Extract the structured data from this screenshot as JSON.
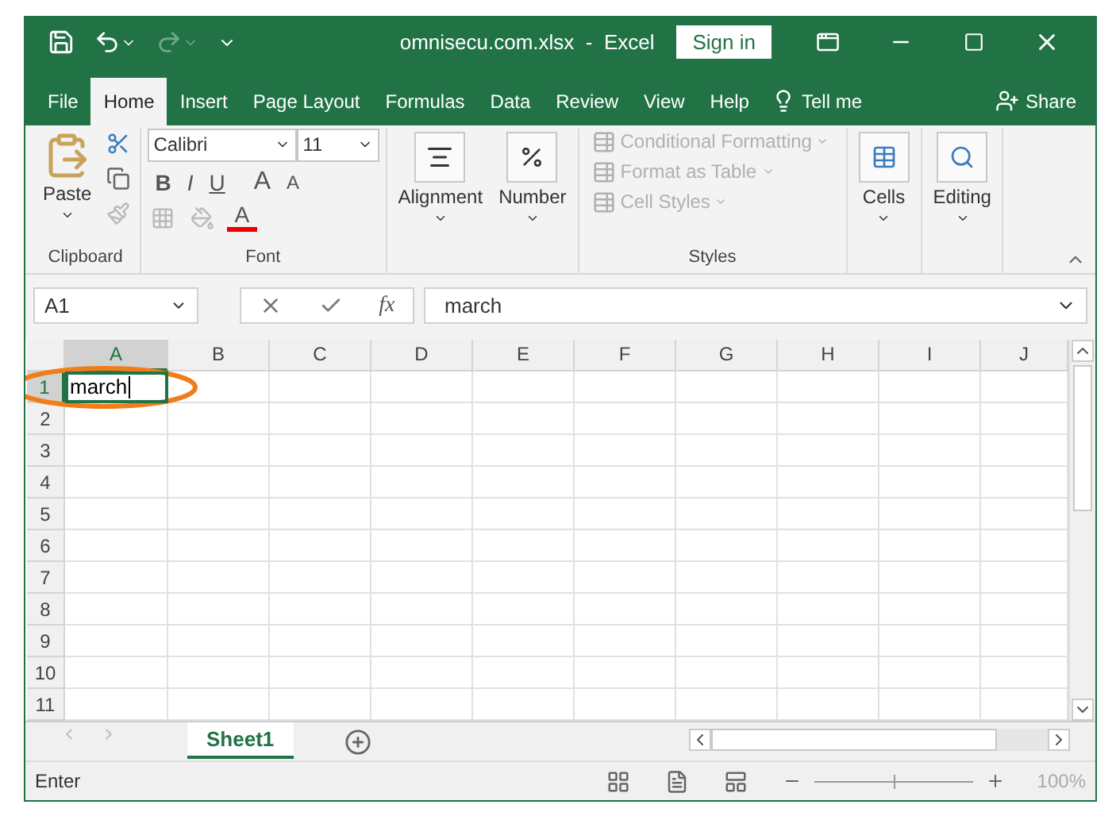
{
  "window": {
    "title": "omnisecu.com.xlsx  -  Excel",
    "sign_in": "Sign in"
  },
  "tabs": [
    {
      "label": "File",
      "selected": false
    },
    {
      "label": "Home",
      "selected": true
    },
    {
      "label": "Insert",
      "selected": false
    },
    {
      "label": "Page Layout",
      "selected": false
    },
    {
      "label": "Formulas",
      "selected": false
    },
    {
      "label": "Data",
      "selected": false
    },
    {
      "label": "Review",
      "selected": false
    },
    {
      "label": "View",
      "selected": false
    },
    {
      "label": "Help",
      "selected": false
    }
  ],
  "tell_me": "Tell me",
  "share": "Share",
  "ribbon": {
    "clipboard": {
      "paste": "Paste",
      "label": "Clipboard"
    },
    "font": {
      "name": "Calibri",
      "size": "11",
      "bold": "B",
      "italic": "I",
      "underline": "U",
      "grow": "A",
      "shrink": "A",
      "font_color_letter": "A",
      "label": "Font"
    },
    "alignment": "Alignment",
    "number": "Number",
    "styles": {
      "items": [
        {
          "label": "Conditional Formatting",
          "disabled": true
        },
        {
          "label": "Format as Table",
          "disabled": true
        },
        {
          "label": "Cell Styles",
          "disabled": true
        }
      ],
      "label": "Styles"
    },
    "cells": "Cells",
    "editing": "Editing"
  },
  "formula_bar": {
    "name_box": "A1",
    "fx": "fx",
    "value": "march"
  },
  "sheet": {
    "columns": [
      "A",
      "B",
      "C",
      "D",
      "E",
      "F",
      "G",
      "H",
      "I",
      "J"
    ],
    "rows": [
      {
        "label": "1",
        "cells": [
          {
            "value": "march",
            "selected": true,
            "editing": true
          }
        ]
      },
      {
        "label": "2"
      },
      {
        "label": "3"
      },
      {
        "label": "4"
      },
      {
        "label": "5"
      },
      {
        "label": "6"
      },
      {
        "label": "7"
      },
      {
        "label": "8"
      },
      {
        "label": "9"
      },
      {
        "label": "10"
      },
      {
        "label": "11"
      }
    ]
  },
  "annotations": [
    {
      "kind": "ellipse"
    }
  ],
  "sheet_tabs": [
    {
      "label": "Sheet1",
      "selected": true
    }
  ],
  "status": {
    "mode": "Enter",
    "zoom": "100%",
    "zoom_slider": {
      "level": 0.5
    }
  }
}
